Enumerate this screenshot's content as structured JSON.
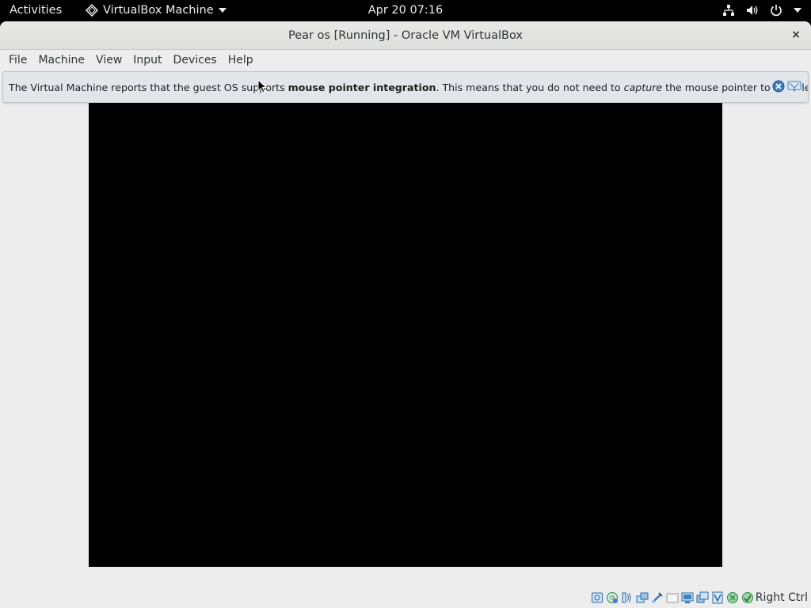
{
  "topbar": {
    "activities": "Activities",
    "app_name": "VirtualBox Machine",
    "clock": "Apr 20  07:16"
  },
  "window": {
    "title": "Pear os [Running] - Oracle VM VirtualBox",
    "close": "×"
  },
  "menubar": {
    "items": [
      "File",
      "Machine",
      "View",
      "Input",
      "Devices",
      "Help"
    ]
  },
  "notice": {
    "text_1": "The Virtual Machine reports that the guest OS supports ",
    "bold": "mouse pointer integration",
    "text_2": ". This means that you do not need to ",
    "italic": "capture",
    "text_3": " the mouse pointer to be able to use it in"
  },
  "statusbar": {
    "host_key": "Right Ctrl",
    "icons": [
      "hard-disk-icon",
      "optical-drive-icon",
      "audio-icon",
      "network-icon",
      "usb-icon",
      "shared-folders-icon",
      "display-icon",
      "video-capture-icon",
      "virtualization-icon",
      "mouse-integration-icon",
      "keyboard-capture-icon"
    ]
  },
  "colors": {
    "topbar_bg": "#000000",
    "window_bg": "#ededed",
    "notice_bg": "#e2e6ea",
    "vm_screen": "#000000",
    "accent_blue": "#3d7fc1"
  }
}
